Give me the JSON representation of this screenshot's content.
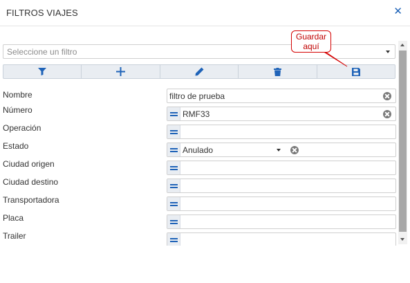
{
  "dialog": {
    "title": "FILTROS VIAJES",
    "close_icon": "close-icon"
  },
  "filter_select": {
    "placeholder": "Seleccione un filtro"
  },
  "toolbar": {
    "buttons": [
      {
        "icon": "filter-icon"
      },
      {
        "icon": "plus-icon"
      },
      {
        "icon": "pencil-icon"
      },
      {
        "icon": "trash-icon"
      },
      {
        "icon": "save-icon"
      }
    ]
  },
  "annotation": {
    "line1": "Guardar",
    "line2": "aquí"
  },
  "fields": [
    {
      "label": "Nombre",
      "value": "filtro de prueba"
    },
    {
      "label": "Número",
      "value": "RMF33"
    },
    {
      "label": "Operación",
      "value": ""
    },
    {
      "label": "Estado",
      "value": "Anulado"
    },
    {
      "label": "Ciudad origen",
      "value": ""
    },
    {
      "label": "Ciudad destino",
      "value": ""
    },
    {
      "label": "Transportadora",
      "value": ""
    },
    {
      "label": "Placa",
      "value": ""
    },
    {
      "label": "Trailer",
      "value": ""
    }
  ],
  "colors": {
    "accent": "#1f63b8",
    "callout_border": "#d40000"
  }
}
